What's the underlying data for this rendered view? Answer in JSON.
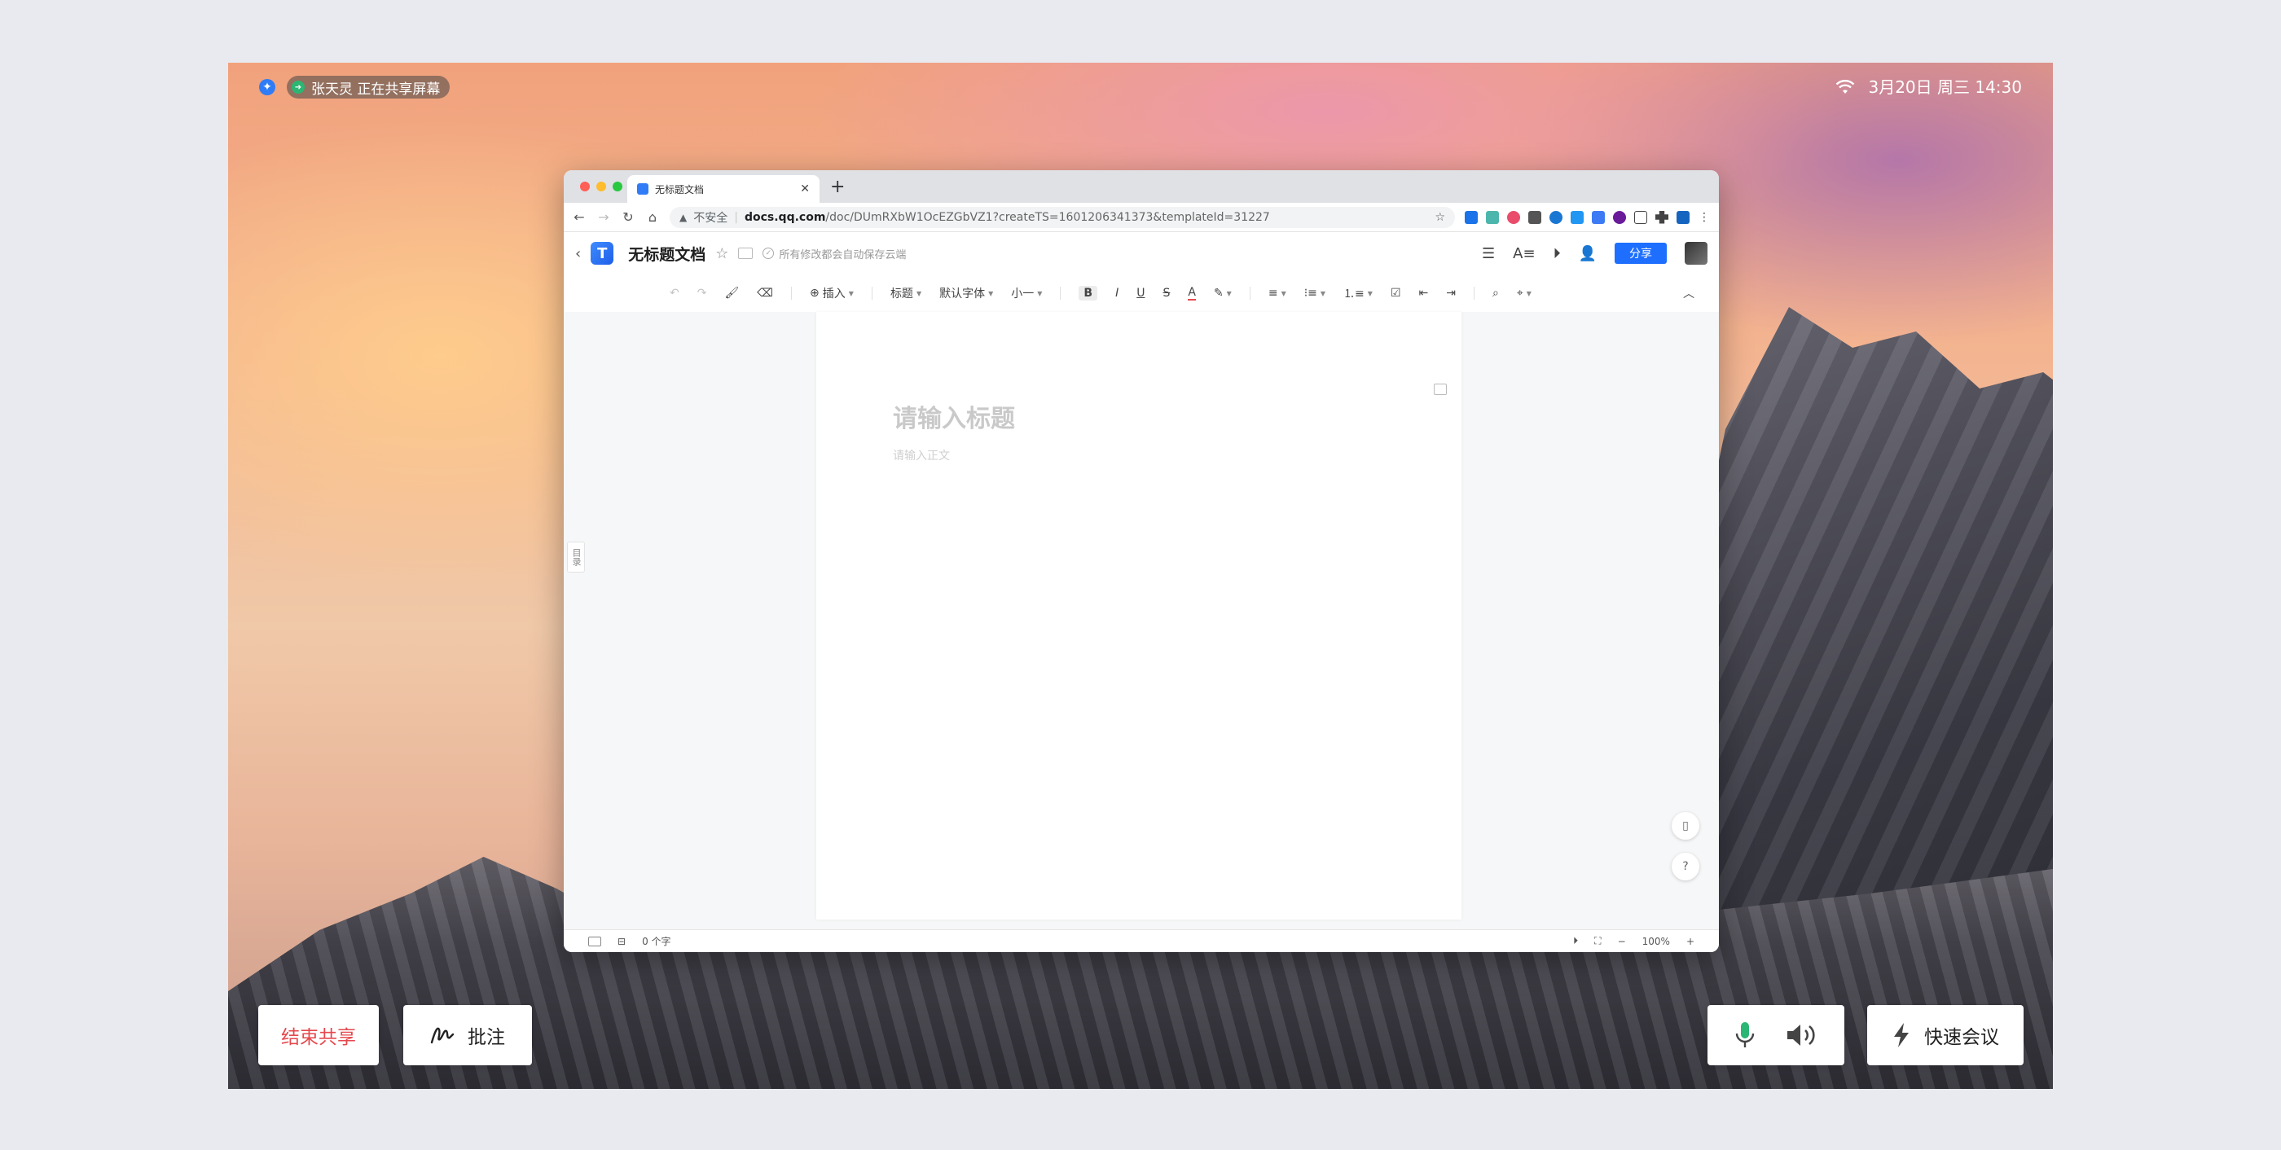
{
  "meeting": {
    "presenter_status": "张天灵 正在共享屏幕",
    "datetime": "3月20日 周三 14:30",
    "controls": {
      "stop_share": "结束共享",
      "annotate": "批注",
      "quick_meeting": "快速会议"
    }
  },
  "browser": {
    "tab_title": "无标题文档",
    "security_label": "不安全",
    "url_host": "docs.qq.com",
    "url_path": "/doc/DUmRXbW1OcEZGbVZ1?createTS=1601206341373&templateId=31227"
  },
  "doc": {
    "title": "无标题文档",
    "save_status": "所有修改都会自动保存云端",
    "share_label": "分享",
    "toolbar": {
      "insert": "插入",
      "heading": "标题",
      "font": "默认字体",
      "size": "小一",
      "bold": "B",
      "italic": "I",
      "underline": "U",
      "strike": "S",
      "color": "A"
    },
    "title_placeholder": "请输入标题",
    "body_placeholder": "请输入正文",
    "toc_label": "目录",
    "word_count": "0 个字",
    "zoom": "100%"
  },
  "colors": {
    "accent": "#1e6fff",
    "stop_red": "#e5484d",
    "mic_green": "#2bb673"
  }
}
